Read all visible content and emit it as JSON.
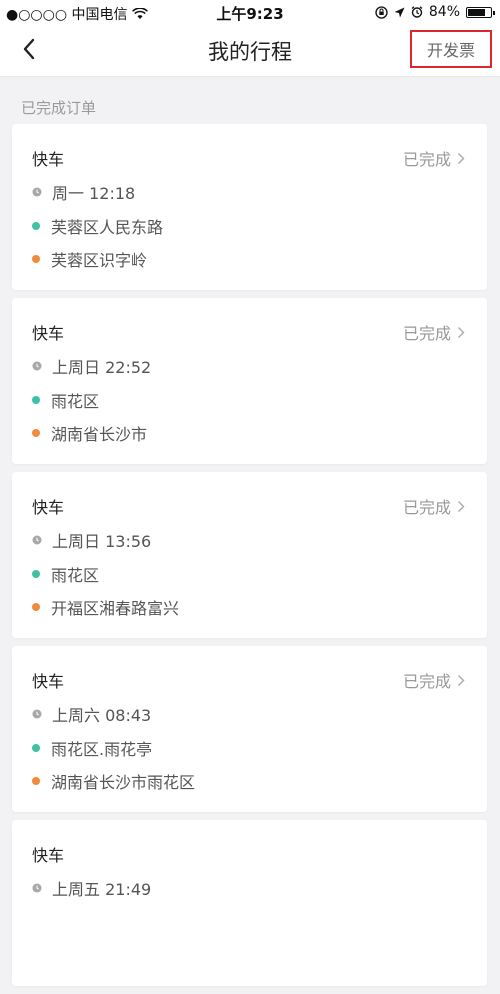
{
  "status_bar": {
    "carrier": "●○○○○ 中国电信",
    "time": "上午9:23",
    "battery": "84%",
    "battery_level": 0.84
  },
  "nav": {
    "title": "我的行程",
    "invoice_label": "开发票"
  },
  "section_label": "已完成订单",
  "colors": {
    "start_dot": "#3ec1a4",
    "end_dot": "#f08a3c",
    "highlight_border": "#d9282f"
  },
  "trips": [
    {
      "type": "快车",
      "status": "已完成",
      "time": "周一 12:18",
      "from": "芙蓉区人民东路",
      "to": "芙蓉区识字岭"
    },
    {
      "type": "快车",
      "status": "已完成",
      "time": "上周日 22:52",
      "from": "雨花区",
      "to": "湖南省长沙市"
    },
    {
      "type": "快车",
      "status": "已完成",
      "time": "上周日 13:56",
      "from": "雨花区",
      "to": "开福区湘春路富兴"
    },
    {
      "type": "快车",
      "status": "已完成",
      "time": "上周六 08:43",
      "from": "雨花区.雨花亭",
      "to": "湖南省长沙市雨花区"
    },
    {
      "type": "快车",
      "status": "",
      "time": "上周五 21:49",
      "from": "",
      "to": ""
    }
  ]
}
